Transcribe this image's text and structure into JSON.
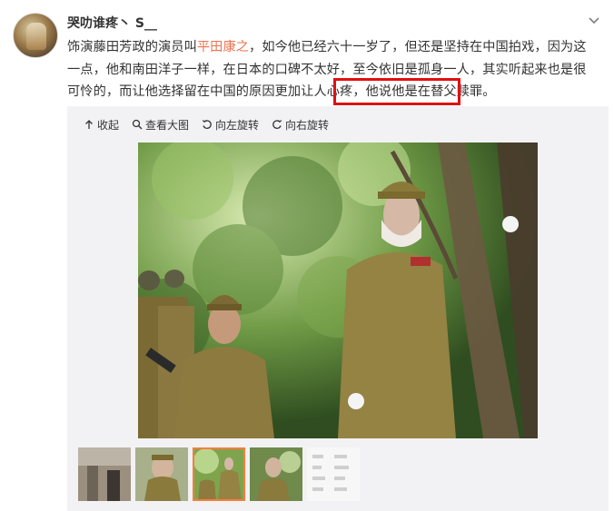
{
  "user": {
    "name": "哭叻谁疼丶 S__",
    "avatar_icon": "avatar-image"
  },
  "post": {
    "part1": "饰演藤田芳政的演员叫",
    "mention": "平田康之",
    "part2": "，如今他已经六十一岁了，但还是坚持在中国拍戏，因为这一点，他和南田洋子一样，在日本的口碑不太好，至今依旧是孤身一人，其实听起来也是很可怜的，而让他选择留在中国的原因更加让人心疼，",
    "highlight": "他说他是在替父赎罪。"
  },
  "toolbar": {
    "collapse": "收起",
    "view_large": "查看大图",
    "rotate_left": "向左旋转",
    "rotate_right": "向右旋转"
  },
  "thumbnails": {
    "count": 5,
    "active_index": 2
  },
  "colors": {
    "mention": "#eb7350",
    "highlight_border": "#e01010",
    "active_thumb": "#fa7d3c"
  }
}
